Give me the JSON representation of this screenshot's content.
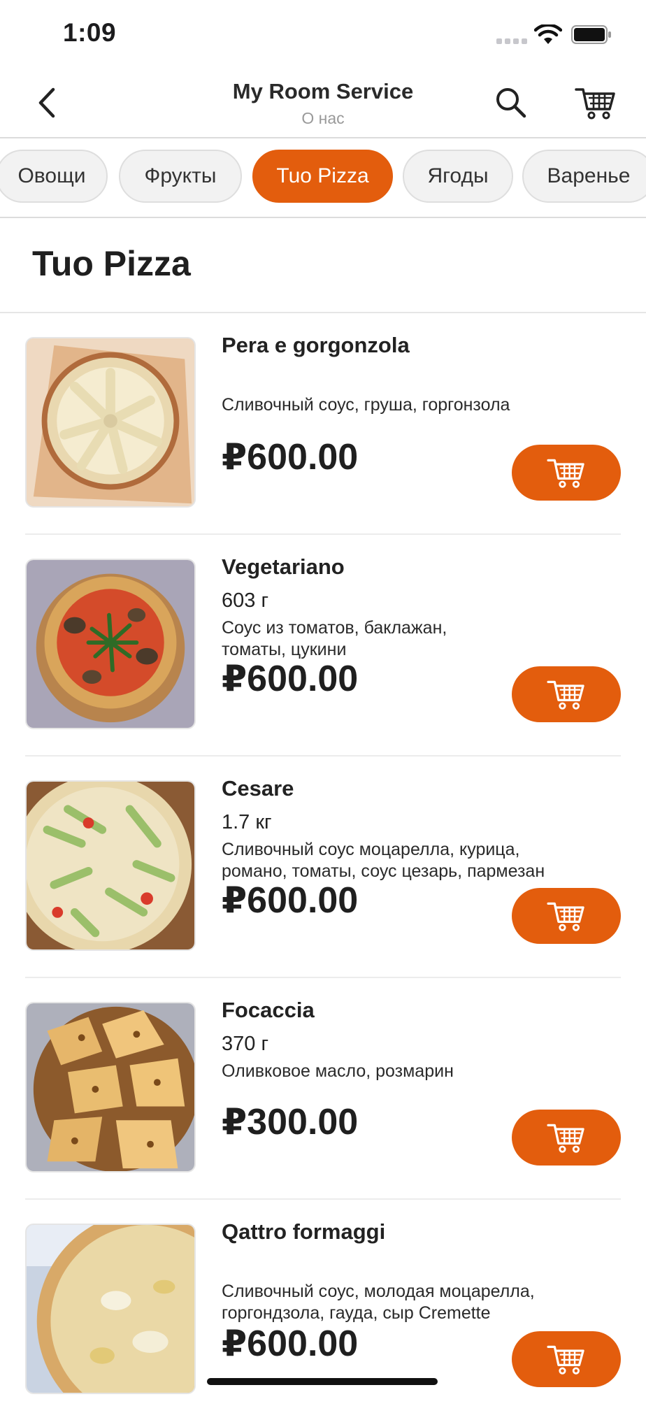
{
  "status_bar": {
    "time": "1:09"
  },
  "nav": {
    "title": "My Room Service",
    "subtitle": "О нас",
    "back_icon": "chevron-left-icon",
    "search_icon": "search-icon",
    "cart_icon": "cart-icon"
  },
  "categories": [
    {
      "label": "Овощи",
      "active": false
    },
    {
      "label": "Фрукты",
      "active": false
    },
    {
      "label": "Tuo Pizza",
      "active": true
    },
    {
      "label": "Ягоды",
      "active": false
    },
    {
      "label": "Варенье",
      "active": false
    }
  ],
  "section": {
    "title": "Tuo Pizza"
  },
  "products": [
    {
      "name": "Pera e gorgonzola",
      "weight": "",
      "description_lines": [
        "Сливочный соус, груша, горгонзола"
      ],
      "price": "₽600.00"
    },
    {
      "name": "Vegetariano",
      "weight": "603 г",
      "description_lines": [
        "Соус из томатов, баклажан,",
        "томаты, цукини"
      ],
      "price": "₽600.00"
    },
    {
      "name": "Cesare",
      "weight": "1.7 кг",
      "description_lines": [
        "Сливочный соус моцарелла, курица,",
        "романо, томаты, соус цезарь, пармезан"
      ],
      "price": "₽600.00"
    },
    {
      "name": "Focaccia",
      "weight": "370 г",
      "description_lines": [
        "Оливковое масло, розмарин"
      ],
      "price": "₽300.00"
    },
    {
      "name": "Qattro formaggi",
      "weight": "",
      "description_lines": [
        "Сливочный соус, молодая моцарелла,",
        "горгондзола, гауда, сыр Cremette"
      ],
      "price": "₽600.00"
    }
  ],
  "colors": {
    "accent": "#e35d0d",
    "chip_bg": "#f2f2f2",
    "text": "#1f1f1f",
    "muted": "#9a9a9a"
  }
}
